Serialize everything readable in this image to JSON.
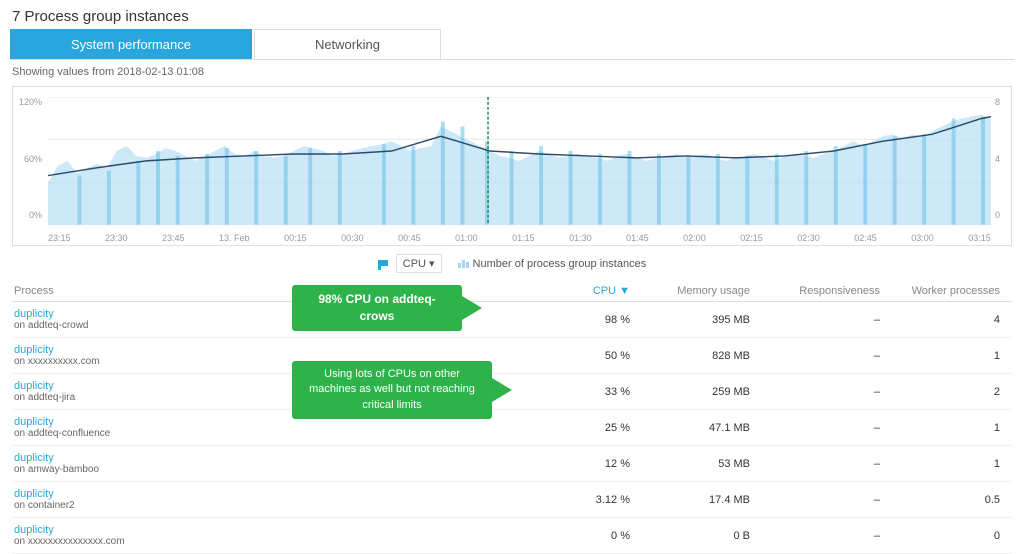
{
  "header": {
    "count": "7",
    "title": "Process group instances"
  },
  "tabs": [
    {
      "label": "System performance",
      "active": true
    },
    {
      "label": "Networking",
      "active": false
    }
  ],
  "subtitle": "Showing values from 2018-02-13 01:08",
  "chart": {
    "y_labels": [
      "120%",
      "60%",
      "0%"
    ],
    "y_labels_right": [
      "8",
      "4",
      "0"
    ],
    "x_labels": [
      "23:15",
      "23:30",
      "23:45",
      "13. Feb",
      "00:15",
      "00:30",
      "00:45",
      "01:00",
      "01:15",
      "01:30",
      "01:45",
      "02:00",
      "02:15",
      "02:30",
      "02:45",
      "03:00",
      "03:15"
    ]
  },
  "legend": {
    "cpu_label": "CPU",
    "instances_label": "Number of process group instances"
  },
  "table": {
    "columns": [
      "Process",
      "CPU ▼",
      "Memory usage",
      "Responsiveness",
      "Worker processes"
    ],
    "rows": [
      {
        "name": "duplicity",
        "host": "on addteq-crowd",
        "cpu": "98 %",
        "memory": "395 MB",
        "responsiveness": "–",
        "workers": "4"
      },
      {
        "name": "duplicity",
        "host": "on xxxxxxxxxx.com",
        "cpu": "50 %",
        "memory": "828 MB",
        "responsiveness": "–",
        "workers": "1"
      },
      {
        "name": "duplicity",
        "host": "on addteq-jira",
        "cpu": "33 %",
        "memory": "259 MB",
        "responsiveness": "–",
        "workers": "2"
      },
      {
        "name": "duplicity",
        "host": "on addteq-confluence",
        "cpu": "25 %",
        "memory": "47.1 MB",
        "responsiveness": "–",
        "workers": "1"
      },
      {
        "name": "duplicity",
        "host": "on amway-bamboo",
        "cpu": "12 %",
        "memory": "53 MB",
        "responsiveness": "–",
        "workers": "1"
      },
      {
        "name": "duplicity",
        "host": "on container2",
        "cpu": "3.12 %",
        "memory": "17.4 MB",
        "responsiveness": "–",
        "workers": "0.5"
      },
      {
        "name": "duplicity",
        "host": "on xxxxxxxxxxxxxxx.com",
        "cpu": "0 %",
        "memory": "0 B",
        "responsiveness": "–",
        "workers": "0"
      }
    ],
    "annotation1": "98% CPU on addteq-crows",
    "annotation2": "Using lots of CPUs on other machines as\nwell but not reaching critical limits"
  }
}
